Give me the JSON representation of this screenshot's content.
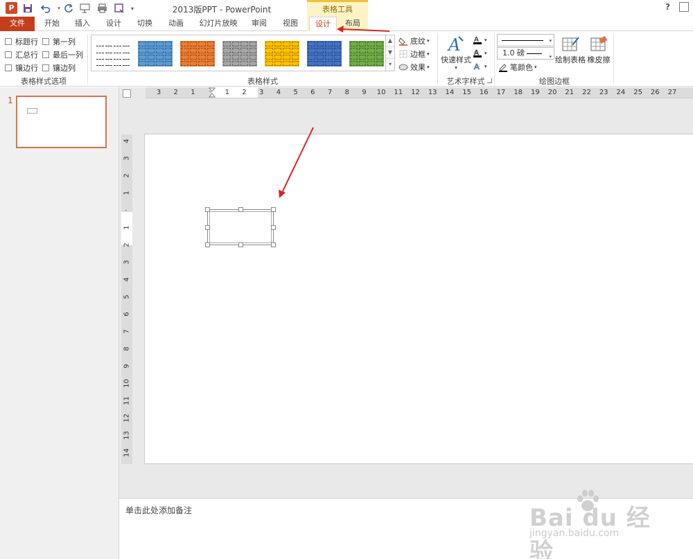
{
  "titlebar": {
    "title": "2013版PPT - PowerPoint",
    "tool_context": "表格工具",
    "help": "?",
    "app_icon": "P"
  },
  "tabs": {
    "file": "文件",
    "home": "开始",
    "insert": "插入",
    "design_main": "设计",
    "transitions": "切换",
    "animations": "动画",
    "slideshow": "幻灯片放映",
    "review": "审阅",
    "view": "视图",
    "table_design": "设计",
    "table_layout": "布局"
  },
  "ribbon": {
    "style_options": {
      "header_row": "标题行",
      "first_column": "第一列",
      "total_row": "汇总行",
      "last_column": "最后一列",
      "banded_rows": "镶边行",
      "banded_columns": "镶边列",
      "group_label": "表格样式选项"
    },
    "table_styles": {
      "group_label": "表格样式",
      "swatch_colors": [
        "#ffffff",
        "#5b9bd5",
        "#ed7d31",
        "#a5a5a5",
        "#ffc000",
        "#4472c4",
        "#70ad47"
      ],
      "shading": "底纹",
      "borders": "边框",
      "effects": "效果"
    },
    "wordart": {
      "quick_styles": "快速样式",
      "group_label": "艺术字样式"
    },
    "draw_borders": {
      "pen_weight": "1.0 磅",
      "pen_color": "笔颜色",
      "draw_table": "绘制表格",
      "eraser": "橡皮擦",
      "group_label": "绘图边框"
    }
  },
  "thumbnails": {
    "slide_number": "1"
  },
  "ruler": {
    "horizontal": [
      "3",
      "2",
      "1",
      "",
      "1",
      "2",
      "3",
      "4",
      "5",
      "6",
      "7",
      "8",
      "9",
      "10",
      "11",
      "12",
      "13",
      "14",
      "15",
      "16",
      "17",
      "18",
      "19",
      "20",
      "21",
      "22",
      "23",
      "24",
      "25",
      "26",
      "27"
    ],
    "vertical": [
      "4",
      "3",
      "2",
      "1",
      "",
      "1",
      "2",
      "3",
      "4",
      "5",
      "6",
      "7",
      "8",
      "9",
      "10",
      "11",
      "12",
      "13",
      "14"
    ]
  },
  "notes": {
    "placeholder": "单击此处添加备注"
  },
  "watermark": {
    "logo": "Bai du 经验",
    "url": "jingyan.baidu.com"
  },
  "colors": {
    "accent": "#c43e1c",
    "context_tab": "#fdf3c7",
    "annotation_arrow": "#e02020"
  }
}
